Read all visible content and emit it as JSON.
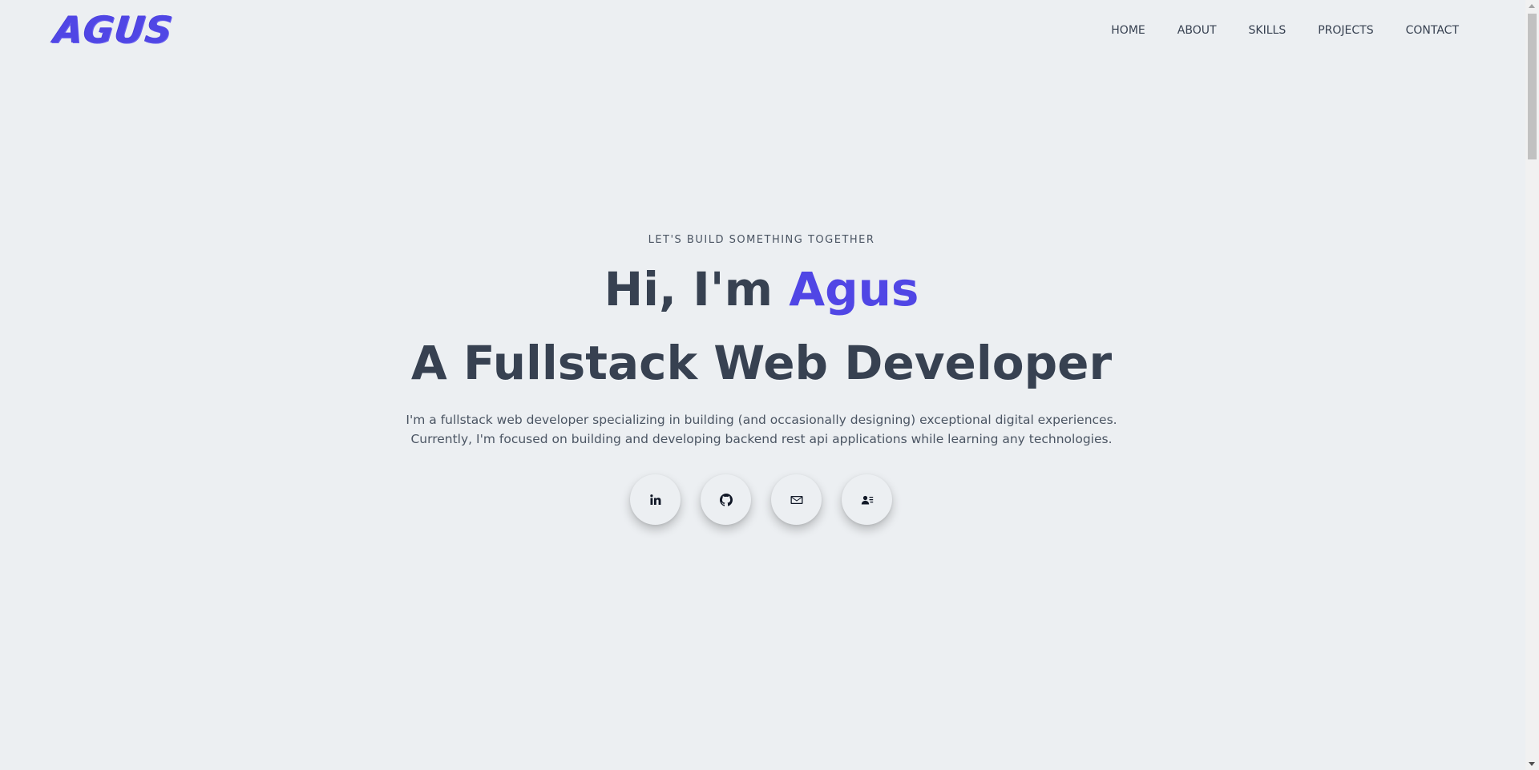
{
  "header": {
    "logo": "AGUS",
    "nav": [
      {
        "label": "HOME"
      },
      {
        "label": "ABOUT"
      },
      {
        "label": "SKILLS"
      },
      {
        "label": "PROJECTS"
      },
      {
        "label": "CONTACT"
      }
    ]
  },
  "hero": {
    "eyebrow": "LET'S BUILD SOMETHING TOGETHER",
    "greeting_prefix": "Hi, I'm ",
    "greeting_name": "Agus",
    "role": "A Fullstack Web Developer",
    "intro_line_1": "I'm a fullstack web developer specializing in building (and occasionally designing) exceptional digital experiences.",
    "intro_line_2": "Currently, I'm focused on building and developing backend rest api applications while learning any technologies.",
    "socials": [
      {
        "icon": "linkedin-icon"
      },
      {
        "icon": "github-icon"
      },
      {
        "icon": "mail-icon"
      },
      {
        "icon": "contact-card-icon"
      }
    ]
  },
  "colors": {
    "accent": "#5046e5",
    "background": "#eceff2",
    "text": "#374151"
  }
}
